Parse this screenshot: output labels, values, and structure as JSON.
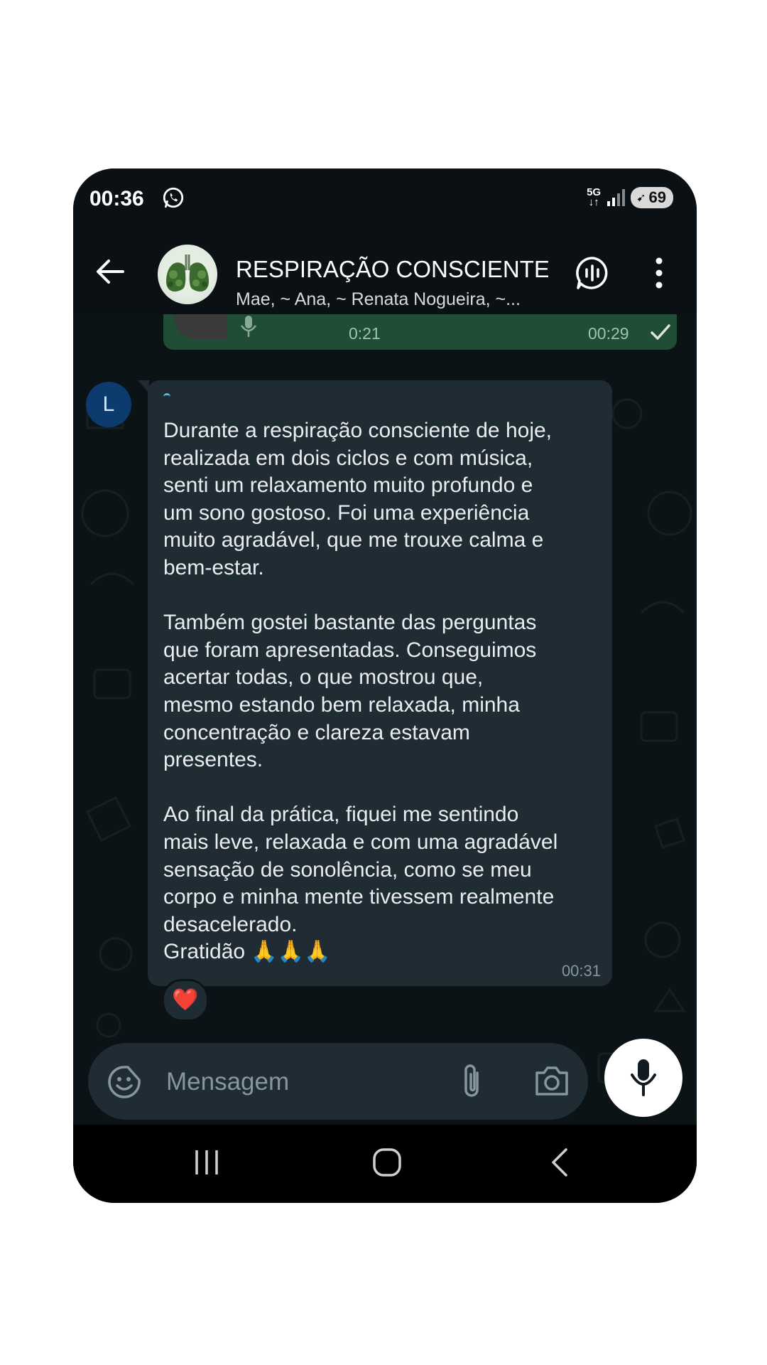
{
  "status_bar": {
    "time": "00:36",
    "network": "5G",
    "battery": "69"
  },
  "header": {
    "title": "RESPIRAÇÃO CONSCIENTE...",
    "subtitle": "Mae, ~ Ana, ~ Renata Nogueira, ~..."
  },
  "outgoing_message": {
    "duration": "0:21",
    "time": "00:29"
  },
  "incoming_message": {
    "sender_initial": "L",
    "text": "Durante a respiração consciente de hoje,\nrealizada em dois ciclos e com música,\nsenti um relaxamento muito profundo e\num sono gostoso. Foi uma experiência\nmuito agradável, que me trouxe calma e\nbem-estar.\n\nTambém gostei bastante das perguntas\nque foram apresentadas. Conseguimos\nacertar todas, o que mostrou que,\nmesmo estando bem relaxada, minha\nconcentração e clareza estavam\npresentes.\n\nAo final da prática, fiquei me sentindo\nmais leve, relaxada e com uma agradável\nsensação de sonolência, como se meu\ncorpo e minha mente tivessem realmente\ndesacelerado.\nGratidão 🙏🙏🙏",
    "time": "00:31",
    "reaction": "❤️"
  },
  "composer": {
    "placeholder": "Mensagem"
  },
  "colors": {
    "outgoing_bubble": "#1f4d36",
    "incoming_bubble": "#202c33",
    "background": "#0c1317",
    "accent": "#53bdeb"
  }
}
